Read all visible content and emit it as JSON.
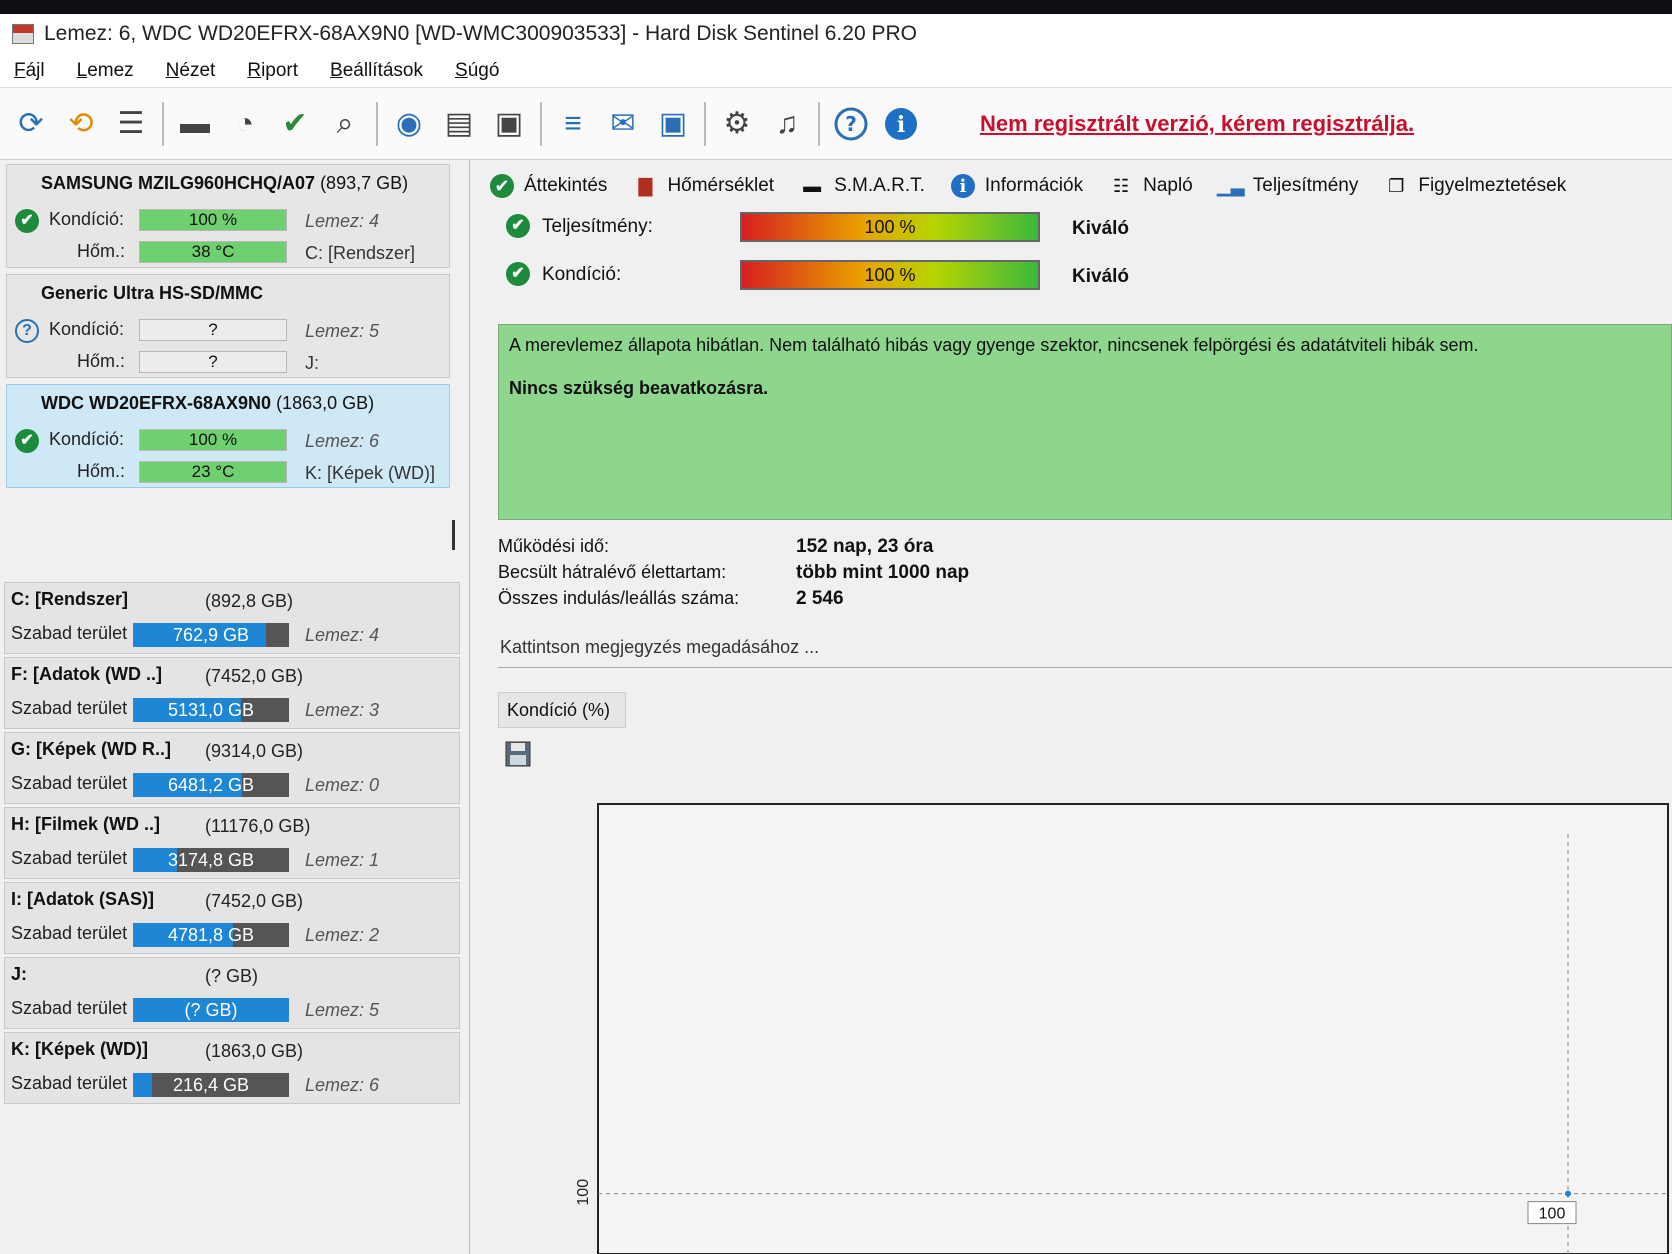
{
  "window": {
    "title": "Lemez: 6, WDC WD20EFRX-68AX9N0 [WD-WMC300903533]  -  Hard Disk Sentinel 6.20 PRO"
  },
  "menu": [
    "Fájl",
    "Lemez",
    "Nézet",
    "Riport",
    "Beállítások",
    "Súgó"
  ],
  "toolbar": {
    "icons": [
      "refresh-icon",
      "refresh-all-icon",
      "list-icon",
      "disk-icon",
      "disk-clock-icon",
      "disk-check-icon",
      "disk-search-icon",
      "globe-disk-icon",
      "network-disk-icon",
      "external-disk-icon",
      "report-icon",
      "mail-icon",
      "monitor-icon",
      "settings-icon",
      "sound-icon",
      "help-icon",
      "info-icon"
    ],
    "register_link": "Nem regisztrált verzió, kérem regisztrálja."
  },
  "disks": [
    {
      "name": "SAMSUNG MZILG960HCHQ/A07",
      "size": "(893,7 GB)",
      "status": "ok",
      "condition_label": "Kondíció:",
      "condition": "100 %",
      "condition_fraction": 1.0,
      "temp_label": "Hőm.:",
      "temp": "38 °C",
      "disk": "Lemez: 4",
      "volume": "C: [Rendszer]"
    },
    {
      "name": "Generic Ultra HS-SD/MMC",
      "size": "",
      "status": "unknown",
      "condition_label": "Kondíció:",
      "condition": "?",
      "condition_fraction": 0,
      "temp_label": "Hőm.:",
      "temp": "?",
      "disk": "Lemez: 5",
      "volume": "J:"
    },
    {
      "name": "WDC WD20EFRX-68AX9N0",
      "size": "(1863,0 GB)",
      "status": "ok",
      "condition_label": "Kondíció:",
      "condition": "100 %",
      "condition_fraction": 1.0,
      "temp_label": "Hőm.:",
      "temp": "23 °C",
      "disk": "Lemez: 6",
      "volume": "K: [Képek (WD)]"
    }
  ],
  "volumes": [
    {
      "name": "C: [Rendszer]",
      "size": "(892,8 GB)",
      "free_label": "Szabad terület",
      "free": "762,9 GB",
      "disk": "Lemez: 4"
    },
    {
      "name": "F: [Adatok (WD ..]",
      "size": "(7452,0 GB)",
      "free_label": "Szabad terület",
      "free": "5131,0 GB",
      "disk": "Lemez: 3"
    },
    {
      "name": "G: [Képek (WD R..]",
      "size": "(9314,0 GB)",
      "free_label": "Szabad terület",
      "free": "6481,2 GB",
      "disk": "Lemez: 0"
    },
    {
      "name": "H: [Filmek (WD ..]",
      "size": "(11176,0 GB)",
      "free_label": "Szabad terület",
      "free": "3174,8 GB",
      "disk": "Lemez: 1"
    },
    {
      "name": "I: [Adatok (SAS)]",
      "size": "(7452,0 GB)",
      "free_label": "Szabad terület",
      "free": "4781,8 GB",
      "disk": "Lemez: 2"
    },
    {
      "name": "J:",
      "size": "(? GB)",
      "free_label": "Szabad terület",
      "free": "(? GB)",
      "disk": "Lemez: 5"
    },
    {
      "name": "K: [Képek (WD)]",
      "size": "(1863,0 GB)",
      "free_label": "Szabad terület",
      "free": "216,4 GB",
      "disk": "Lemez: 6"
    }
  ],
  "tabs": [
    {
      "label": "Áttekintés",
      "icon": "check-icon"
    },
    {
      "label": "Hőmérséklet",
      "icon": "thermometer-icon"
    },
    {
      "label": "S.M.A.R.T.",
      "icon": "smart-icon"
    },
    {
      "label": "Információk",
      "icon": "info-icon"
    },
    {
      "label": "Napló",
      "icon": "log-icon"
    },
    {
      "label": "Teljesítmény",
      "icon": "performance-icon"
    },
    {
      "label": "Figyelmeztetések",
      "icon": "alerts-icon"
    }
  ],
  "overview": {
    "performance_label": "Teljesítmény:",
    "performance": "100 %",
    "performance_grade": "Kiváló",
    "condition_label": "Kondíció:",
    "condition": "100 %",
    "condition_grade": "Kiváló",
    "status_text": "A merevlemez állapota hibátlan. Nem található hibás vagy gyenge szektor, nincsenek felpörgési és adatátviteli hibák sem.",
    "action_text": "Nincs szükség beavatkozásra.",
    "uptime_label": "Működési idő:",
    "uptime": "152 nap, 23 óra",
    "lifetime_label": "Becsült hátralévő élettartam:",
    "lifetime": "több mint 1000 nap",
    "starts_label": "Összes indulás/leállás száma:",
    "starts": "2 546",
    "note_placeholder": "Kattintson megjegyzés megadásához ..."
  },
  "chart_tab": "Kondíció  (%)",
  "chart_data": {
    "type": "line",
    "title": "",
    "y_tick_labels": [
      "100"
    ],
    "series": [
      {
        "values": [
          100
        ]
      }
    ],
    "point_label": "100",
    "grid": true
  }
}
